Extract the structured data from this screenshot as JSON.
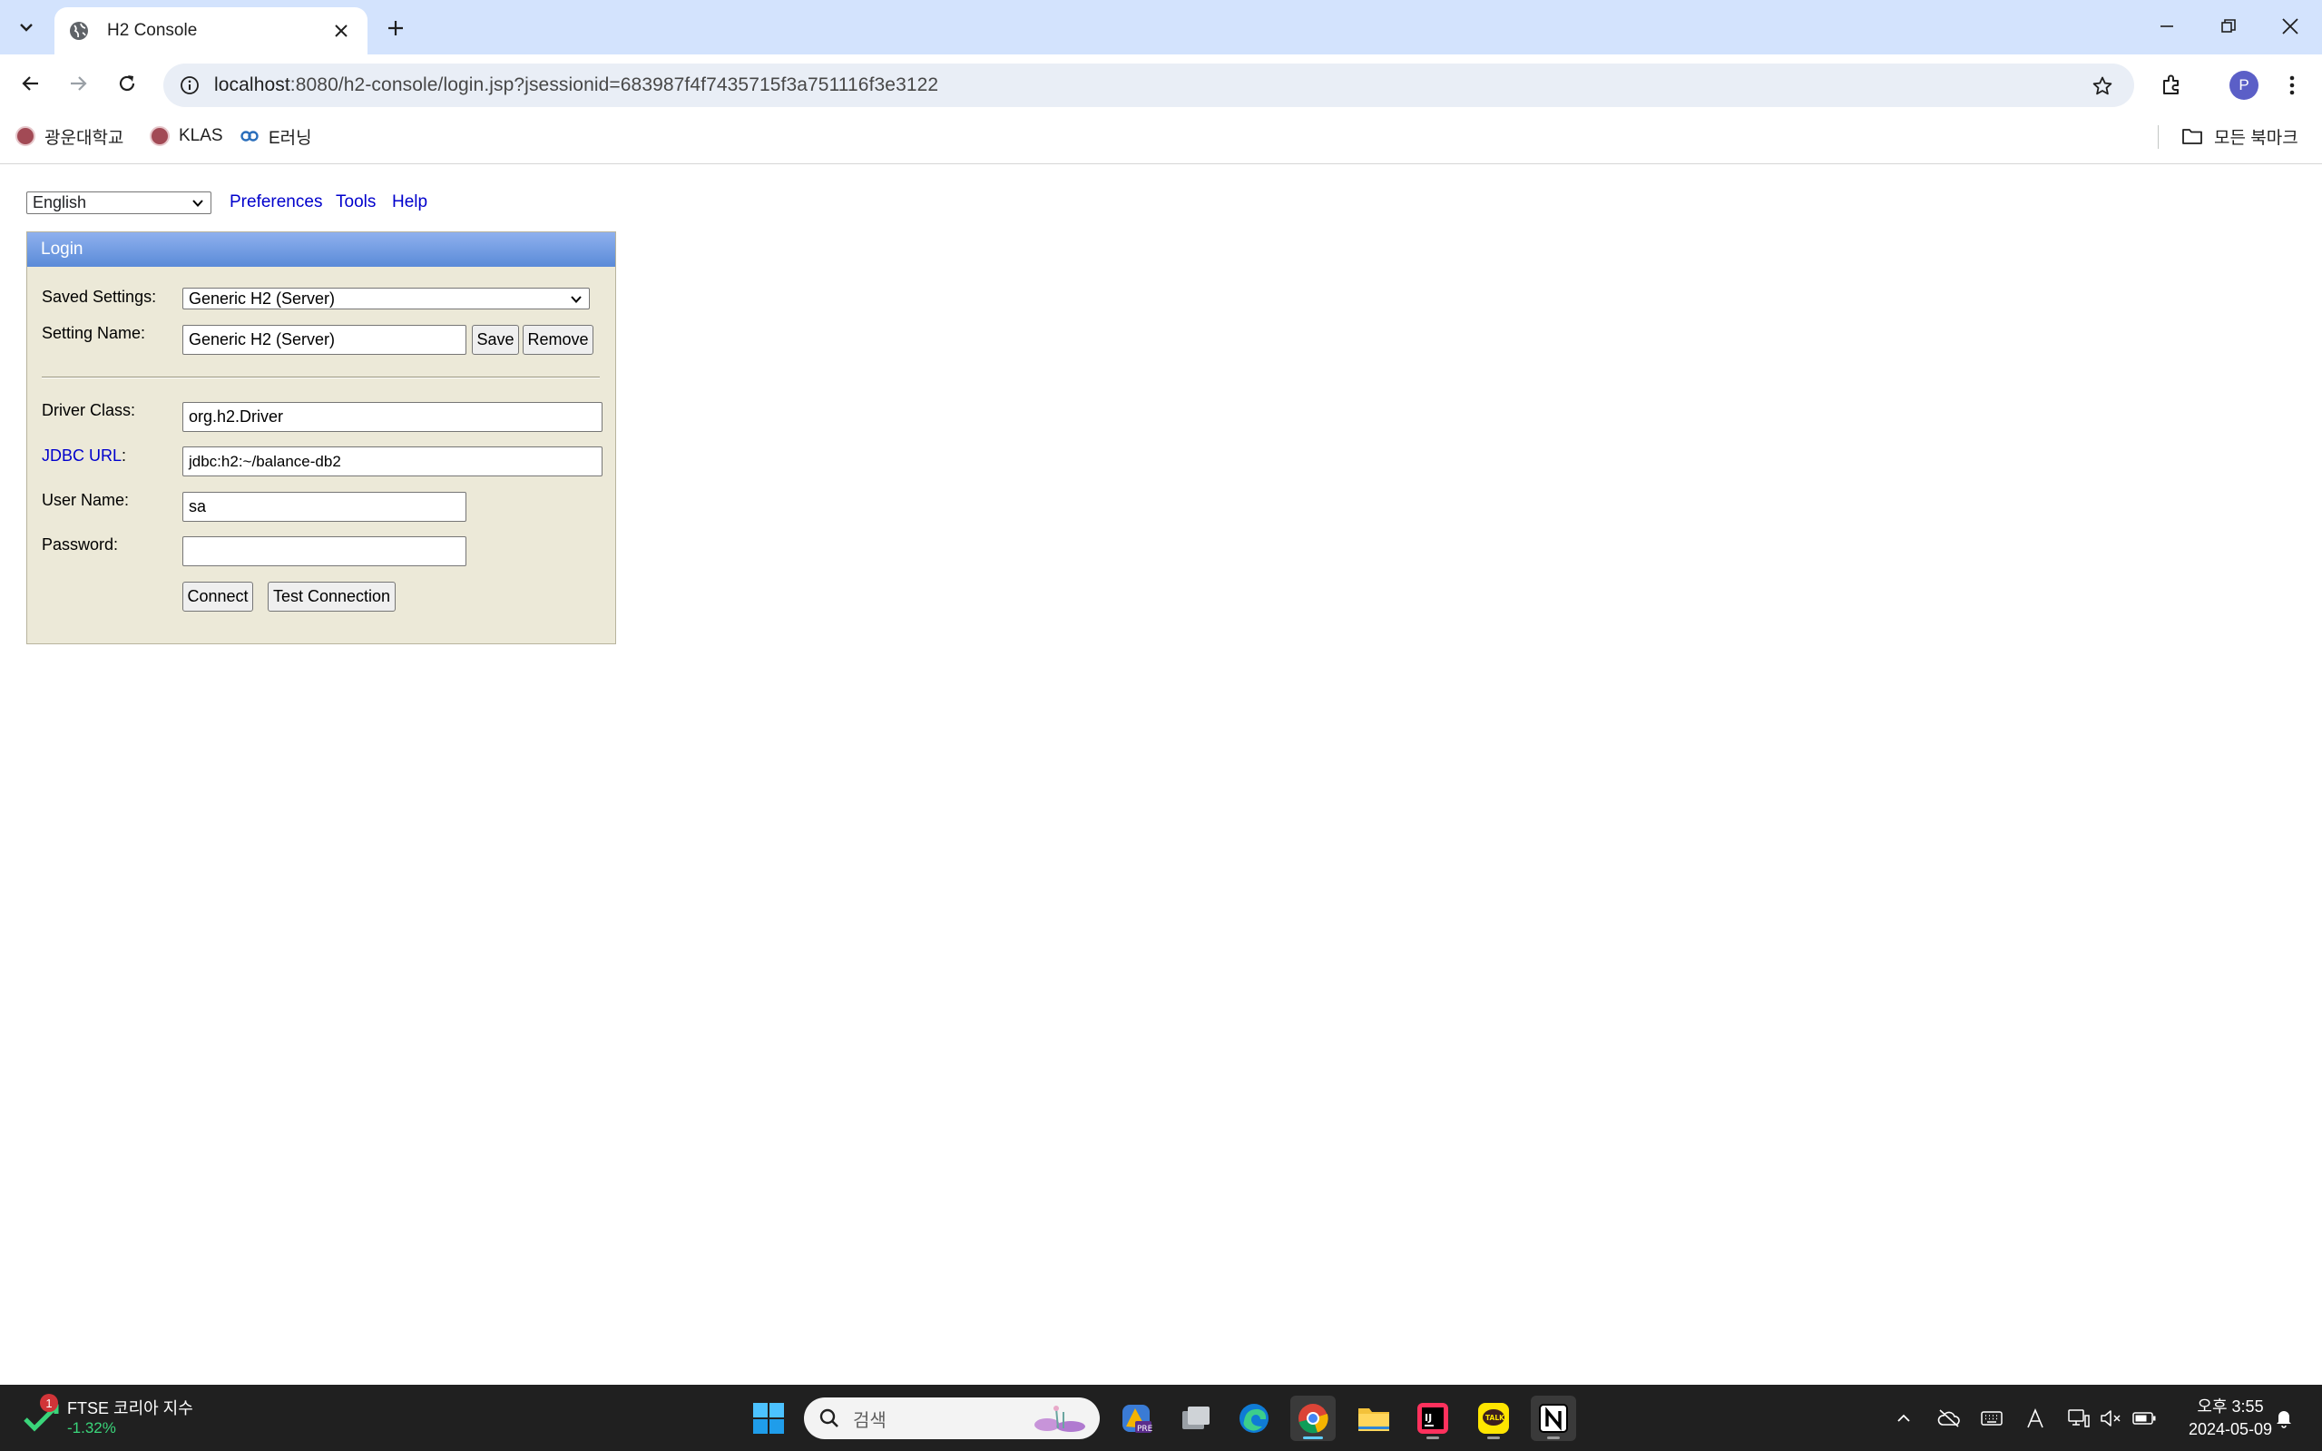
{
  "browser": {
    "tab_title": "H2 Console",
    "url_host": "localhost",
    "url_rest": ":8080/h2-console/login.jsp?jsessionid=683987f4f7435715f3a751116f3e3122",
    "profile_initial": "P",
    "bookmarks": [
      "광운대학교",
      "KLAS",
      "E러닝"
    ],
    "all_bookmarks": "모든 북마크"
  },
  "page": {
    "language": "English",
    "links": [
      "Preferences",
      "Tools",
      "Help"
    ],
    "login": {
      "header": "Login",
      "saved_settings_label": "Saved Settings:",
      "saved_settings_value": "Generic H2 (Server)",
      "setting_name_label": "Setting Name:",
      "setting_name_value": "Generic H2 (Server)",
      "save_label": "Save",
      "remove_label": "Remove",
      "driver_class_label": "Driver Class:",
      "driver_class_value": "org.h2.Driver",
      "jdbc_url_label": "JDBC URL",
      "jdbc_url_suffix": ":",
      "jdbc_url_value": "jdbc:h2:~/balance-db2",
      "user_name_label": "User Name:",
      "user_name_value": "sa",
      "password_label": "Password:",
      "password_value": "",
      "connect_label": "Connect",
      "test_connection_label": "Test Connection"
    }
  },
  "taskbar": {
    "badge_count": "1",
    "ticker_name": "FTSE 코리아 지수",
    "ticker_change": "-1.32%",
    "search_placeholder": "검색",
    "clock_period_time": "오후 3:55",
    "clock_date": "2024-05-09"
  },
  "colors": {
    "tabstrip": "#d3e3fd",
    "login_header": "#5a8ad8",
    "login_panel": "#ece9d8",
    "link": "#0000cc",
    "taskbar": "#202020"
  }
}
